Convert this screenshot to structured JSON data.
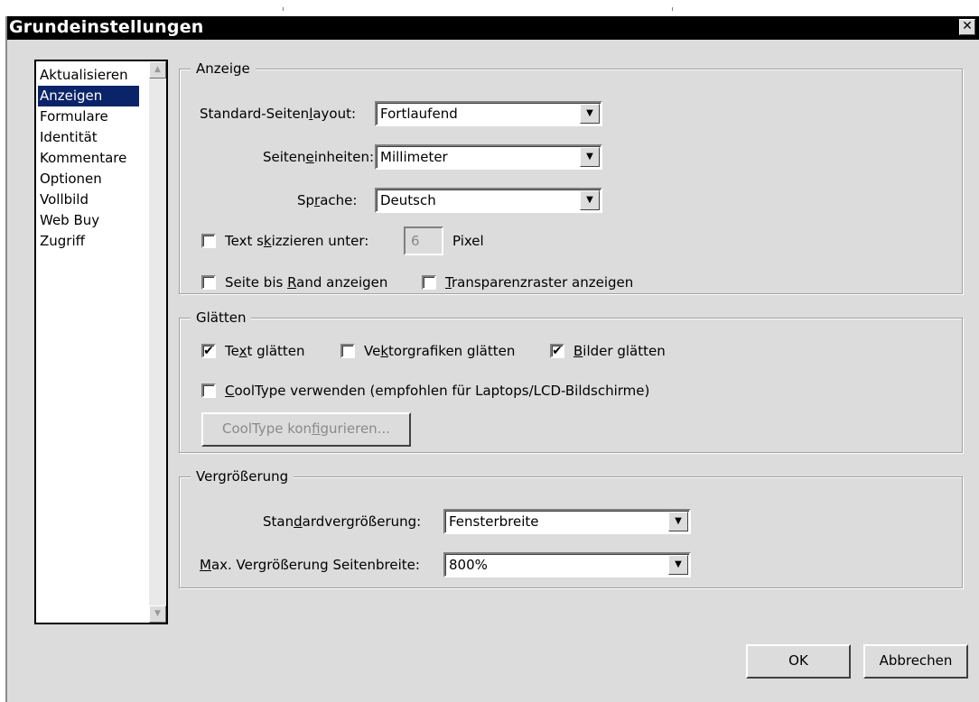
{
  "window": {
    "title": "Grundeinstellungen",
    "close_glyph": "✕"
  },
  "categories": {
    "items": [
      {
        "label": "Aktualisieren",
        "selected": false
      },
      {
        "label": "Anzeigen",
        "selected": true
      },
      {
        "label": "Formulare",
        "selected": false
      },
      {
        "label": "Identität",
        "selected": false
      },
      {
        "label": "Kommentare",
        "selected": false
      },
      {
        "label": "Optionen",
        "selected": false
      },
      {
        "label": "Vollbild",
        "selected": false
      },
      {
        "label": "Web Buy",
        "selected": false
      },
      {
        "label": "Zugriff",
        "selected": false
      }
    ]
  },
  "anzeige": {
    "legend": "Anzeige",
    "layout_label_pre": "Standard-Seiten",
    "layout_label_acc": "l",
    "layout_label_post": "ayout:",
    "layout_value": "Fortlaufend",
    "units_label_pre": "Seiten",
    "units_label_acc": "e",
    "units_label_post": "inheiten:",
    "units_value": "Millimeter",
    "lang_label_pre": "Sp",
    "lang_label_acc": "r",
    "lang_label_post": "ache:",
    "lang_value": "Deutsch",
    "greek_label_pre": "Text s",
    "greek_label_acc": "k",
    "greek_label_post": "izzieren unter:",
    "greek_value": "6",
    "greek_unit": "Pixel",
    "greek_checked": false,
    "edge_label_pre": "Seite bis ",
    "edge_label_acc": "R",
    "edge_label_post": "and anzeigen",
    "edge_checked": false,
    "grid_label_acc": "T",
    "grid_label_post": "ransparenzraster anzeigen",
    "grid_checked": false
  },
  "glaetten": {
    "legend": "Glätten",
    "text_pre": "Te",
    "text_acc": "x",
    "text_post": "t glätten",
    "text_checked": true,
    "vector_pre": "Ve",
    "vector_acc": "k",
    "vector_post": "torgrafiken glätten",
    "vector_checked": false,
    "images_acc": "B",
    "images_post": "ilder glätten",
    "images_checked": true,
    "cooltype_acc": "C",
    "cooltype_post": "oolType verwenden (empfohlen für Laptops/LCD-Bildschirme)",
    "cooltype_checked": false,
    "configure_pre": "CoolType kon",
    "configure_acc": "f",
    "configure_post": "igurieren..."
  },
  "vergroesserung": {
    "legend": "Vergrößerung",
    "std_label_pre": "Stan",
    "std_label_acc": "d",
    "std_label_post": "ardvergrößerung:",
    "std_value": "Fensterbreite",
    "max_label_acc": "M",
    "max_label_post": "ax. Vergrößerung Seitenbreite:",
    "max_value": "800%"
  },
  "footer": {
    "ok_label": "OK",
    "cancel_label": "Abbrechen"
  },
  "glyphs": {
    "dropdown": "▼",
    "scroll_up": "▲",
    "scroll_down": "▼",
    "check": "✔"
  }
}
